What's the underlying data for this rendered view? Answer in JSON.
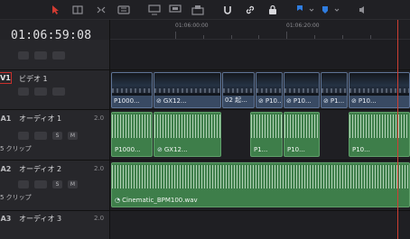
{
  "toolbar": {
    "icons": [
      "pointer-icon",
      "trim-icon",
      "dynamic-trim-icon",
      "blade-icon",
      "overwrite-icon",
      "replace-icon",
      "place-on-top-icon",
      "snap-icon",
      "link-icon",
      "lock-icon",
      "flag-icon",
      "marker-icon",
      "audio-icon"
    ]
  },
  "timecode": "01:06:59:08",
  "ruler": {
    "labels": [
      "01:06:00:00",
      "01:06:20:00"
    ]
  },
  "tracks": {
    "v1": {
      "id": "V1",
      "name": "ビデオ 1"
    },
    "a1": {
      "id": "A1",
      "name": "オーディオ 1",
      "level": "2.0",
      "count": "5 クリップ",
      "solo": "S",
      "mute": "M"
    },
    "a2": {
      "id": "A2",
      "name": "オーディオ 2",
      "level": "2.0",
      "count": "5 クリップ",
      "solo": "S",
      "mute": "M"
    },
    "a3": {
      "id": "A3",
      "name": "オーディオ 3",
      "level": "2.0"
    }
  },
  "video_clips": [
    "P1000...",
    "GX12...",
    "02 起...",
    "P10...",
    "P10...",
    "P1...",
    "P10..."
  ],
  "audio1_clips": [
    "P1000...",
    "GX12...",
    "P1...",
    "P10...",
    "P10..."
  ],
  "audio2_clip": "Cinematic_BPM100.wav",
  "colors": {
    "playhead": "#cf3f33",
    "video_clip": "#394a63",
    "audio_clip": "#3e7e4a",
    "active_track_outline": "#c9302c"
  }
}
